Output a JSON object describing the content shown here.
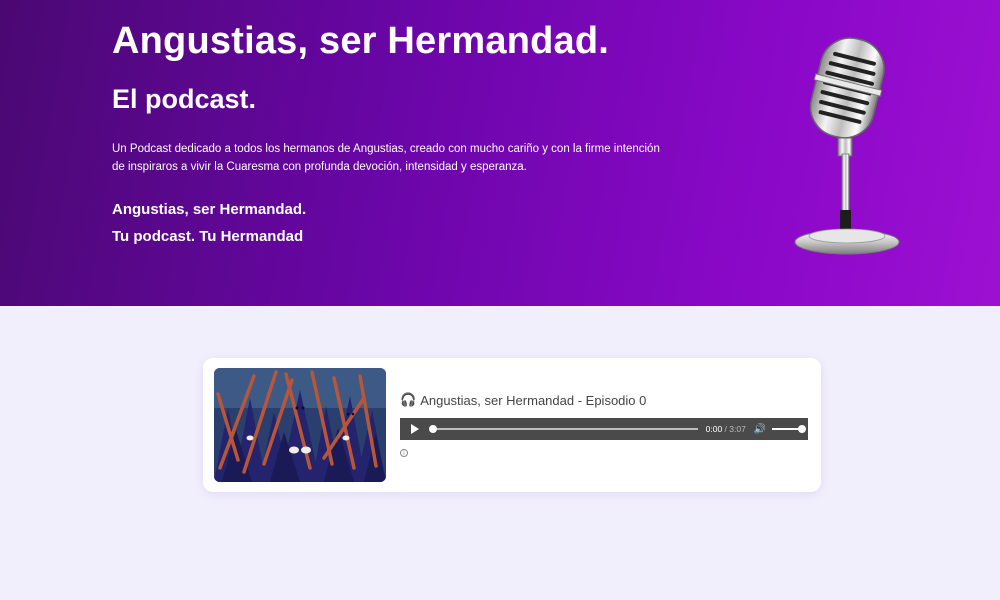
{
  "hero": {
    "title": "Angustias, ser Hermandad.",
    "subtitle": "El podcast.",
    "description": "Un Podcast dedicado a todos los hermanos de Angustias, creado con mucho cariño y con la firme intención de inspiraros a vivir la Cuaresma con profunda devoción, intensidad y esperanza.",
    "tagline_1": "Angustias, ser Hermandad.",
    "tagline_2": "Tu podcast. Tu Hermandad",
    "image_icon": "microphone-icon"
  },
  "episode": {
    "headphones_icon": "headphones-icon",
    "title": "Angustias, ser Hermandad - Episodio 0",
    "thumbnail_icon": "procession-photo",
    "player": {
      "current_time": "0:00",
      "separator": " / ",
      "duration": "3:07",
      "progress": 0,
      "volume": 1.0
    },
    "info_glyph": "i"
  },
  "colors": {
    "hero_start": "#4a0872",
    "hero_end": "#9d10d2",
    "page_background": "#f2effd",
    "player_background": "#4a4a4a"
  }
}
